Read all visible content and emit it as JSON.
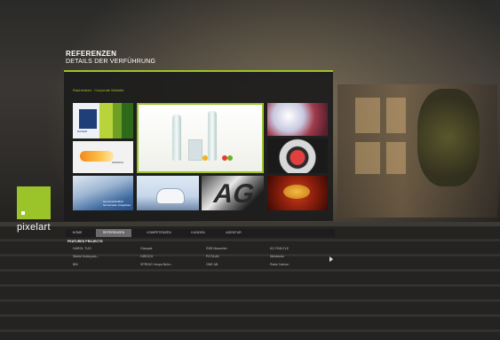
{
  "header": {
    "title": "REFERENZEN",
    "subtitle": "DETAILS DER VERFÜHRUNG"
  },
  "panel": {
    "breadcrumb": "Rauhenbad · Corporate Website",
    "tiles": [
      {
        "name": "rainer",
        "text": "RAINER"
      },
      {
        "name": "pill",
        "text": "WIONIXA"
      },
      {
        "name": "fabric",
        "text": "Gemeinschaftlich Gemeinsam Ausgebaut"
      }
    ]
  },
  "brand": {
    "name": "pixelart"
  },
  "nav": {
    "items": [
      {
        "label": "HOME"
      },
      {
        "label": "REFERENZEN"
      },
      {
        "label": "KOMPETENZEN"
      },
      {
        "label": "KUNDEN"
      },
      {
        "label": "AGENTUR"
      }
    ],
    "active_index": 1
  },
  "featured": {
    "heading": "FEATURED PROJECTS",
    "projects": [
      {
        "label": "HAROL TUO"
      },
      {
        "label": "Glanpak"
      },
      {
        "label": "RKB Maxseller"
      },
      {
        "label": "KO PAN ELE"
      },
      {
        "label": "Stiefel Kuferpoto..."
      },
      {
        "label": "HIROCH"
      },
      {
        "label": "POTA AK"
      },
      {
        "label": "Wiederein"
      },
      {
        "label": "BBI"
      },
      {
        "label": "SPRING Vespa Buhn..."
      },
      {
        "label": "ONE AB"
      },
      {
        "label": "Rabe Carbon"
      }
    ]
  },
  "colors": {
    "accent": "#9bc42a",
    "panel_bg": "#1c1c1c",
    "nav_active": "#6a6a6a"
  }
}
